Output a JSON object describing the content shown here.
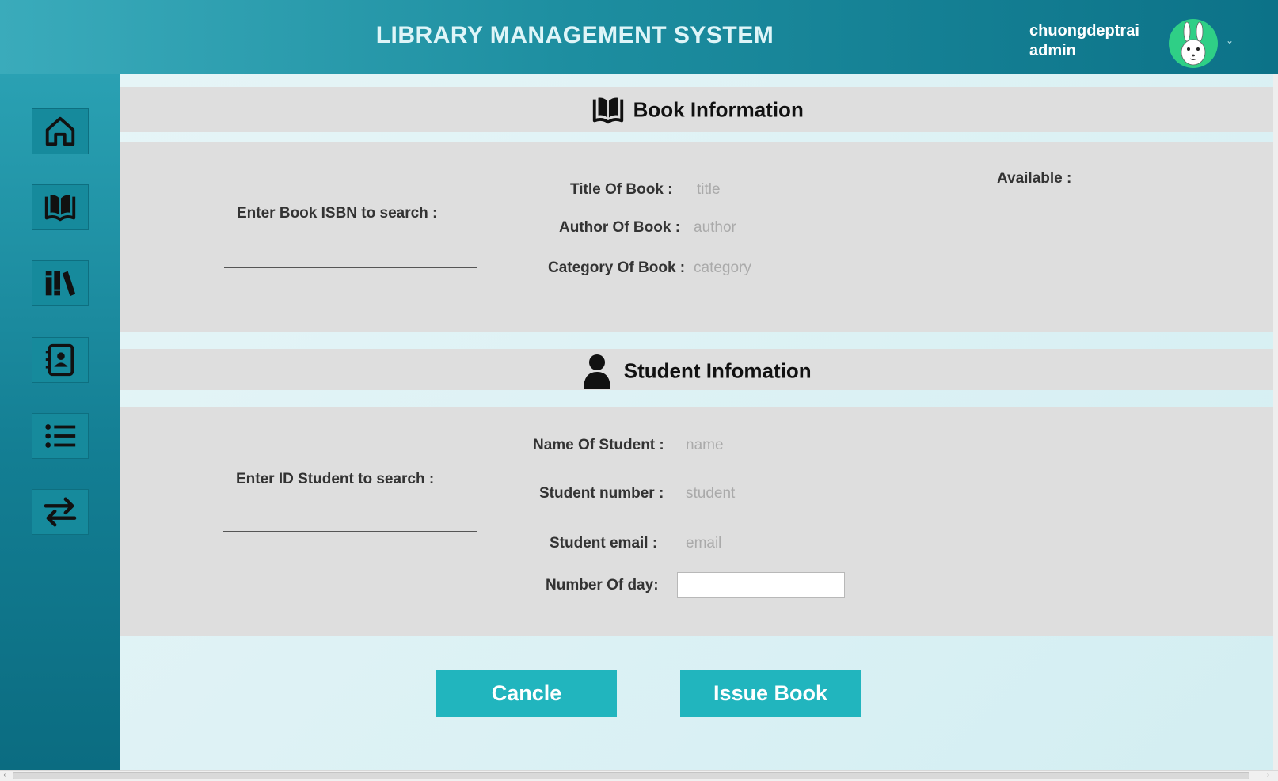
{
  "header": {
    "title": "LIBRARY MANAGEMENT SYSTEM",
    "user_name": "chuongdeptrai",
    "user_role": "admin"
  },
  "sidebar": {
    "items": [
      {
        "icon": "home-icon"
      },
      {
        "icon": "book-icon"
      },
      {
        "icon": "library-icon"
      },
      {
        "icon": "contacts-icon"
      },
      {
        "icon": "list-icon"
      },
      {
        "icon": "transfer-icon"
      }
    ]
  },
  "book_section": {
    "title": "Book Information",
    "isbn_label": "Enter Book ISBN to search :",
    "isbn_value": "",
    "title_label": "Title Of Book :",
    "title_value": "title",
    "author_label": "Author Of Book :",
    "author_value": "author",
    "category_label": "Category Of Book :",
    "category_value": "category",
    "available_label": "Available :"
  },
  "student_section": {
    "title": "Student Infomation",
    "id_label": "Enter ID Student to search :",
    "id_value": "",
    "name_label": "Name Of Student :",
    "name_value": "name",
    "number_label": "Student number :",
    "number_value": "student",
    "email_label": "Student email :",
    "email_value": "email",
    "days_label": "Number Of day:",
    "days_value": ""
  },
  "actions": {
    "cancel_label": "Cancle",
    "issue_label": "Issue Book"
  },
  "colors": {
    "header_start": "#3aabbb",
    "header_end": "#0c7288",
    "button": "#21b5be",
    "panel": "#dedede"
  }
}
